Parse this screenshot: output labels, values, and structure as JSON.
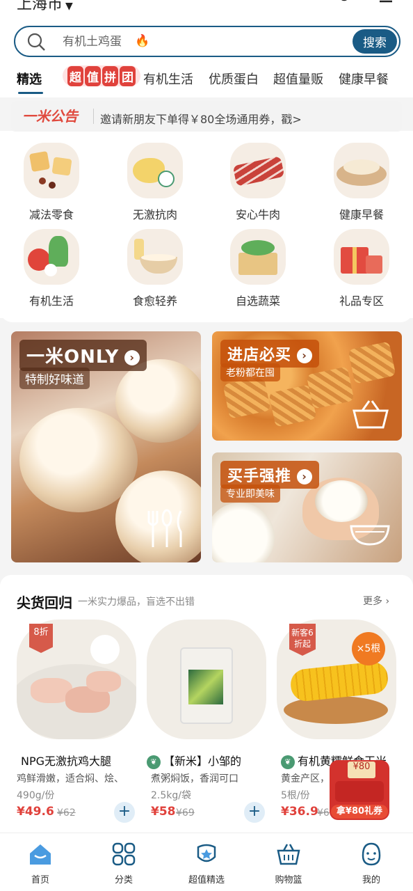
{
  "header": {
    "city": "上海市",
    "search_placeholder": "有机土鸡蛋",
    "search_button": "搜索"
  },
  "tabs": [
    {
      "label": "精选",
      "active": true
    },
    {
      "label": "超值拼团",
      "badge_chars": [
        "超",
        "值",
        "拼",
        "团"
      ]
    },
    {
      "label": "有机生活"
    },
    {
      "label": "优质蛋白"
    },
    {
      "label": "超值量贩"
    },
    {
      "label": "健康早餐"
    }
  ],
  "notice": {
    "brand": "一米公告",
    "text": "邀请新朋友下单得￥80全场通用券，戳>"
  },
  "categories": [
    {
      "label": "减法零食",
      "icon": "snack-icon"
    },
    {
      "label": "无激抗肉",
      "icon": "chicken-icon"
    },
    {
      "label": "安心牛肉",
      "icon": "beef-icon"
    },
    {
      "label": "健康早餐",
      "icon": "breakfast-icon"
    },
    {
      "label": "有机生活",
      "icon": "vegetable-icon"
    },
    {
      "label": "食愈轻养",
      "icon": "porridge-icon"
    },
    {
      "label": "自选蔬菜",
      "icon": "veg-box-icon"
    },
    {
      "label": "礼品专区",
      "icon": "gift-icon"
    }
  ],
  "banners": {
    "big": {
      "title": "一米ONLY",
      "sub": "特制好味道"
    },
    "top_right": {
      "title": "进店必买",
      "sub": "老粉都在囤"
    },
    "bottom_right": {
      "title": "买手强推",
      "sub": "专业即美味"
    }
  },
  "hot_section": {
    "title": "尖货回归",
    "subtitle": "一米实力爆品，盲选不出错",
    "more": "更多",
    "products": [
      {
        "badge": "8折",
        "name": "NPG无激抗鸡大腿",
        "desc": "鸡鲜滑嫩，适合焖、烩、",
        "spec": "490g/份",
        "price": "¥49.6",
        "original": "¥62"
      },
      {
        "name": "【新米】小邹的",
        "desc": "煮粥焖饭，香润可口",
        "spec": "2.5kg/袋",
        "price": "¥58",
        "original": "¥69"
      },
      {
        "badge": "新客6折起",
        "name": "有机黄糯鲜食玉米",
        "desc": "黄金产区，",
        "spec": "5根/份",
        "price": "¥36.9",
        "original": "¥6",
        "count_badge": "×5根"
      }
    ]
  },
  "coupon": {
    "top": "¥80",
    "bottom": "拿¥80礼券"
  },
  "bottom_nav": [
    {
      "label": "首页",
      "icon": "home-icon",
      "active": true
    },
    {
      "label": "分类",
      "icon": "category-icon"
    },
    {
      "label": "超值精选",
      "icon": "star-badge-icon"
    },
    {
      "label": "购物篮",
      "icon": "basket-icon"
    },
    {
      "label": "我的",
      "icon": "profile-icon"
    }
  ],
  "colors": {
    "primary": "#1a5b85",
    "accent_red": "#e0423c"
  }
}
